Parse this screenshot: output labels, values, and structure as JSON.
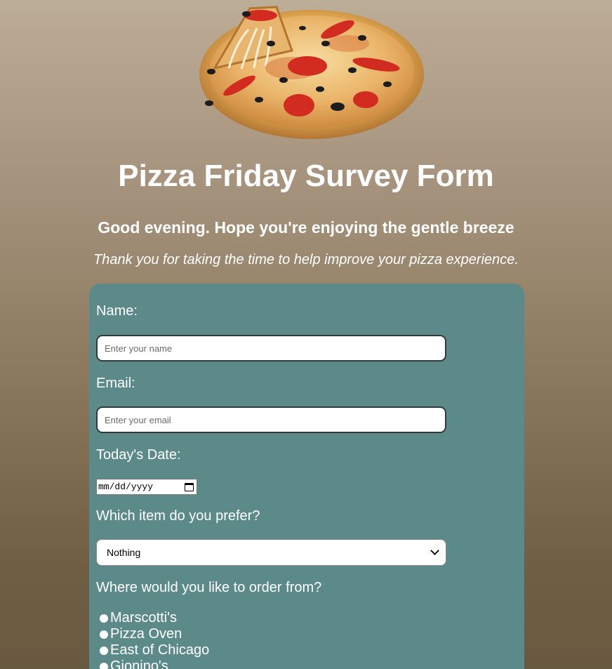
{
  "header": {
    "title": "Pizza Friday Survey Form",
    "greeting": "Good evening. Hope you're enjoying the gentle breeze",
    "subtitle": "Thank you for taking the time to help improve your pizza experience."
  },
  "form": {
    "name": {
      "label": "Name:",
      "placeholder": "Enter your name",
      "value": ""
    },
    "email": {
      "label": "Email:",
      "placeholder": "Enter your email",
      "value": ""
    },
    "date": {
      "label": "Today's Date:",
      "placeholder": "mm/dd/yyyy"
    },
    "item": {
      "label": "Which item do you prefer?",
      "selected": "Nothing"
    },
    "order_from": {
      "label": "Where would you like to order from?",
      "options": [
        "Marscotti's",
        "Pizza Oven",
        "East of Chicago",
        "Gionino's"
      ]
    }
  },
  "colors": {
    "panel": "#5b8a88",
    "background_top": "#bcad97",
    "background_bottom": "#685a41",
    "text": "#ffffff"
  },
  "icons": {
    "date_picker": "calendar-icon",
    "select": "chevron-down-icon"
  }
}
